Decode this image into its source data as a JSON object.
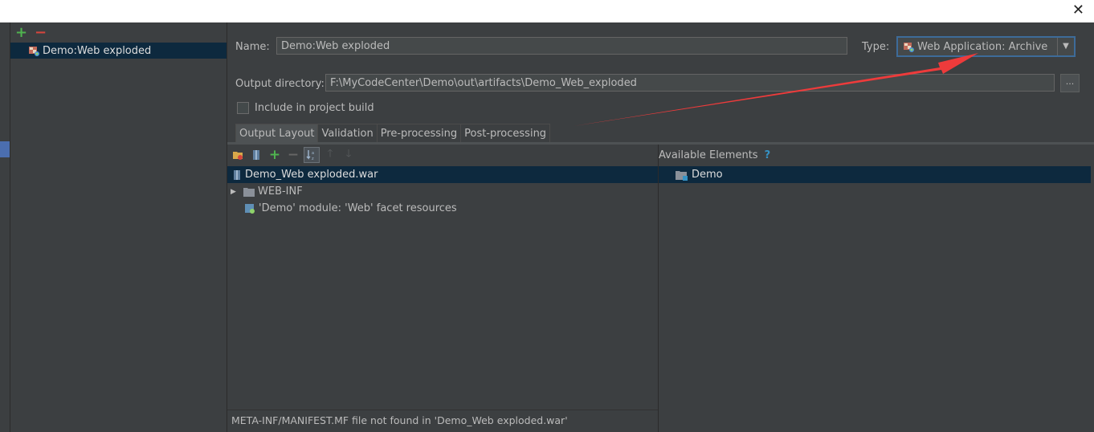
{
  "window": {
    "close_glyph": "✕"
  },
  "sidebar": {
    "add_glyph": "+",
    "remove_glyph": "−",
    "items": [
      {
        "label": "Demo:Web exploded",
        "icon": "web-artifact-icon"
      }
    ]
  },
  "form": {
    "name_label": "Name:",
    "name_value": "Demo:Web exploded",
    "type_label": "Type:",
    "type_value": "Web Application: Archive",
    "output_label": "Output directory:",
    "output_value": "F:\\MyCodeCenter\\Demo\\out\\artifacts\\Demo_Web_exploded",
    "browse_label": "...",
    "include_label": "Include in project build",
    "include_checked": false
  },
  "tabs": [
    {
      "label": "Output Layout",
      "active": true
    },
    {
      "label": "Validation",
      "active": false
    },
    {
      "label": "Pre-processing",
      "active": false
    },
    {
      "label": "Post-processing",
      "active": false
    }
  ],
  "layout": {
    "items": [
      {
        "label": "Demo_Web exploded.war",
        "icon": "archive-icon",
        "selected": true
      },
      {
        "label": "WEB-INF",
        "icon": "folder-icon",
        "expandable": true
      },
      {
        "label": "'Demo' module: 'Web' facet resources",
        "icon": "module-resources-icon"
      }
    ],
    "status": "META-INF/MANIFEST.MF file not found in 'Demo_Web exploded.war'"
  },
  "available": {
    "header": "Available Elements",
    "help_glyph": "?",
    "items": [
      {
        "label": "Demo",
        "icon": "module-folder-icon",
        "selected": true
      }
    ]
  },
  "colors": {
    "accent": "#3d6b99",
    "selection": "#0d293e",
    "annotation_arrow": "#ee3b3b"
  }
}
